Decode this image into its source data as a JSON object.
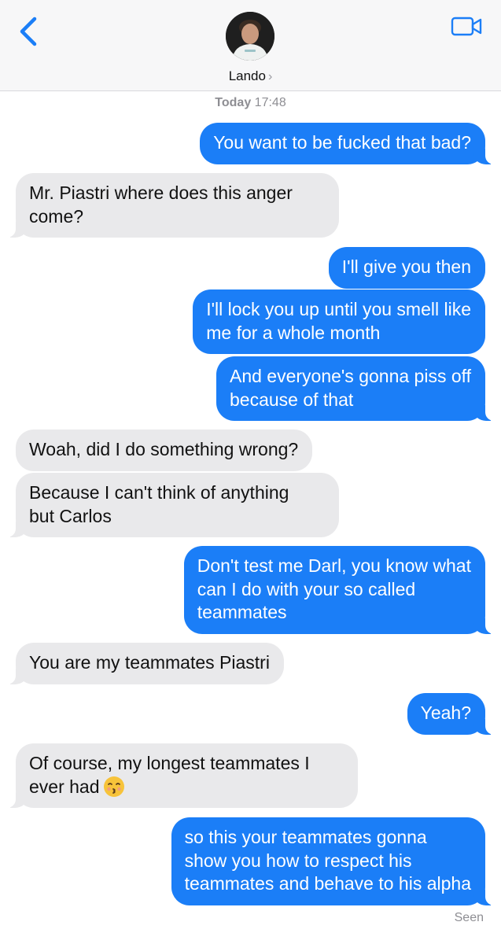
{
  "header": {
    "contact_name": "Lando",
    "chevron": "›",
    "back_icon": "chevron-left-icon",
    "video_icon": "video-camera-icon",
    "accent": "#1b7ef7"
  },
  "timestamp": {
    "day": "Today",
    "time": "17:48"
  },
  "messages": [
    {
      "from": "me",
      "text": "You want to be fucked that bad?"
    },
    {
      "from": "them",
      "text": "Mr. Piastri where does this anger\ncome?"
    },
    {
      "from": "me",
      "text": "I'll give you then"
    },
    {
      "from": "me",
      "text": "I'll lock you up until you smell like\nme for a whole month"
    },
    {
      "from": "me",
      "text": "And everyone's gonna piss off\nbecause of that"
    },
    {
      "from": "them",
      "text": "Woah, did I do something wrong?"
    },
    {
      "from": "them",
      "text": "Because I can't think of anything\nbut Carlos"
    },
    {
      "from": "me",
      "text": "Don't test me Darl, you know what\ncan I do with your so called\nteammates"
    },
    {
      "from": "them",
      "text": "You are my teammates Piastri"
    },
    {
      "from": "me",
      "text": "Yeah?"
    },
    {
      "from": "them",
      "text": "Of course, my longest teammates I\never had",
      "emoji": "kissing-face-emoji"
    },
    {
      "from": "me",
      "text": "so this your teammates gonna\nshow you how to respect his\nteammates and behave to his alpha"
    }
  ],
  "status": {
    "seen": "Seen"
  },
  "colors": {
    "sent_bubble": "#1b7ef7",
    "received_bubble": "#e9e9eb"
  }
}
